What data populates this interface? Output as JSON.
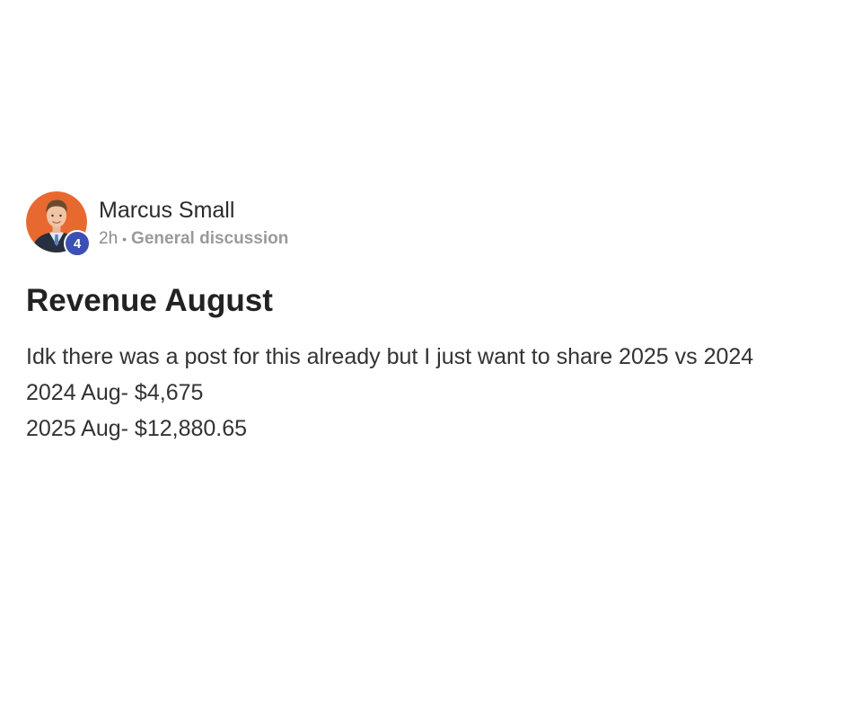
{
  "post": {
    "author": {
      "name": "Marcus Small",
      "level": "4"
    },
    "meta": {
      "time": "2h",
      "separator": "•",
      "category": "General discussion"
    },
    "title": "Revenue August",
    "body_lines": [
      "Idk there was a post for this already but I just want to share 2025 vs 2024",
      "2024 Aug- $4,675",
      "2025 Aug- $12,880.65"
    ]
  },
  "colors": {
    "avatar_bg": "#e8692f",
    "badge_bg": "#3b4fb5",
    "meta_text": "#8c8c8c",
    "title_text": "#222222"
  }
}
